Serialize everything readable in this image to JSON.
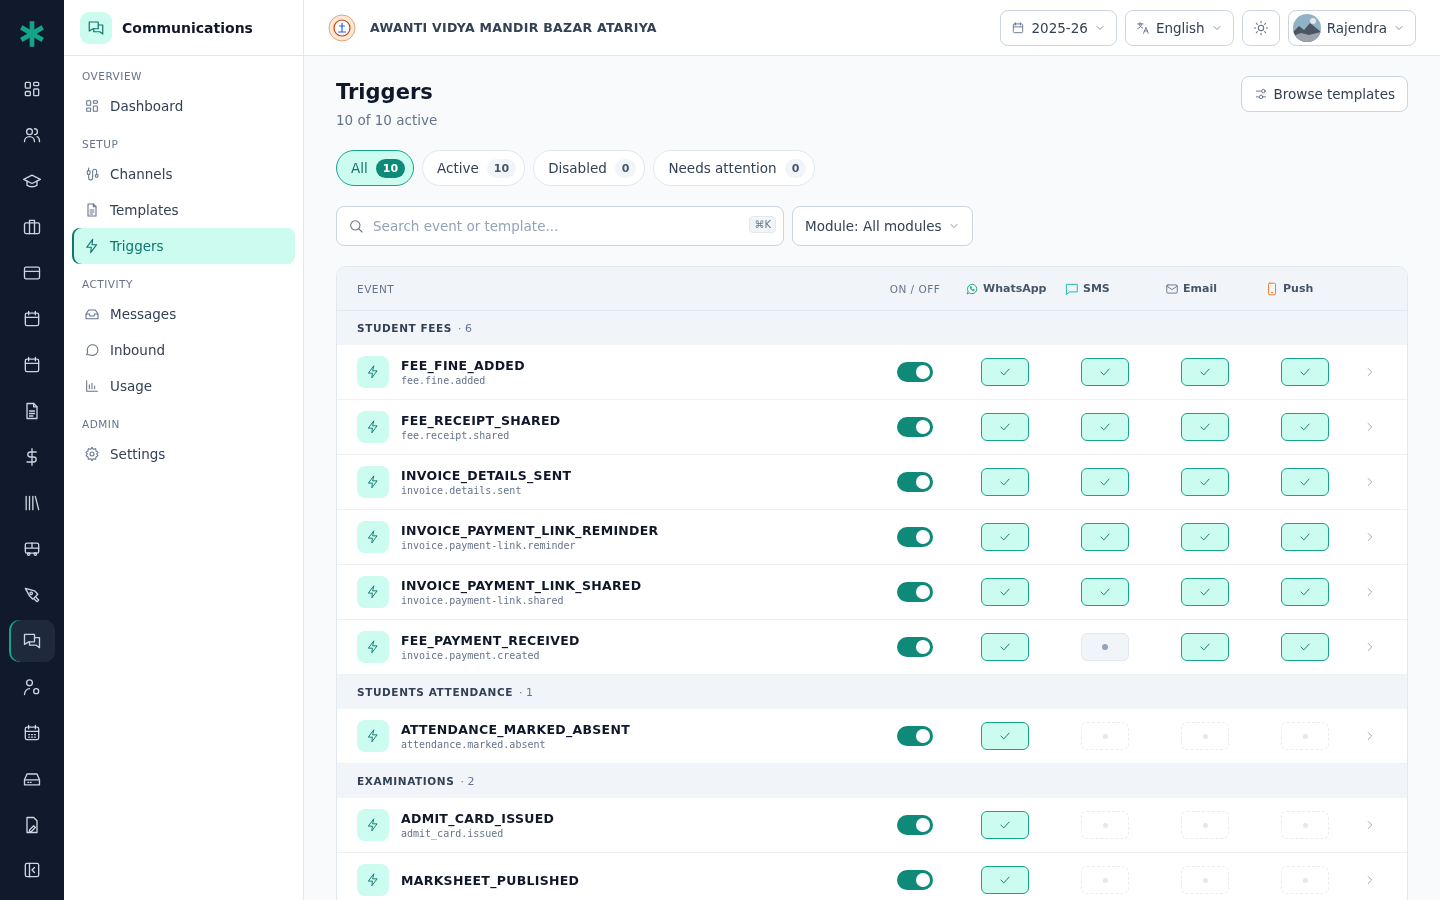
{
  "rail": [
    {
      "kind": "grid",
      "selected": false
    },
    {
      "kind": "users",
      "selected": false
    },
    {
      "kind": "cap",
      "selected": false
    },
    {
      "kind": "briefcase",
      "selected": false
    },
    {
      "kind": "card",
      "selected": false
    },
    {
      "kind": "calendar",
      "selected": false
    },
    {
      "kind": "calendar",
      "selected": false
    },
    {
      "kind": "doc",
      "selected": false
    },
    {
      "kind": "dollar",
      "selected": false
    },
    {
      "kind": "library",
      "selected": false
    },
    {
      "kind": "bus",
      "selected": false
    },
    {
      "kind": "pen",
      "selected": false
    },
    {
      "kind": "chat",
      "selected": true
    },
    {
      "kind": "usergear",
      "selected": false
    },
    {
      "kind": "calgrid",
      "selected": false
    },
    {
      "kind": "tray",
      "selected": false
    },
    {
      "kind": "filepen",
      "selected": false
    }
  ],
  "sidebar": {
    "title": "Communications",
    "sections": [
      {
        "label": "OVERVIEW",
        "items": [
          {
            "kind": "grid",
            "label": "Dashboard",
            "selected": false
          }
        ]
      },
      {
        "label": "SETUP",
        "items": [
          {
            "kind": "plug",
            "label": "Channels",
            "selected": false
          },
          {
            "kind": "doc",
            "label": "Templates",
            "selected": false
          },
          {
            "kind": "bolt",
            "label": "Triggers",
            "selected": true
          }
        ]
      },
      {
        "label": "ACTIVITY",
        "items": [
          {
            "kind": "inbox",
            "label": "Messages",
            "selected": false
          },
          {
            "kind": "bubble",
            "label": "Inbound",
            "selected": false
          },
          {
            "kind": "bars",
            "label": "Usage",
            "selected": false
          }
        ]
      },
      {
        "label": "ADMIN",
        "items": [
          {
            "kind": "gear",
            "label": "Settings",
            "selected": false
          }
        ]
      }
    ]
  },
  "header": {
    "school": "AWANTI VIDYA MANDIR BAZAR ATARIYA",
    "year": "2025-26",
    "language": "English",
    "user": "Rajendra"
  },
  "page": {
    "title": "Triggers",
    "subtitle": "10 of 10 active",
    "action": "Browse templates"
  },
  "filters": [
    {
      "label": "All",
      "count": "10",
      "selected": true
    },
    {
      "label": "Active",
      "count": "10",
      "selected": false
    },
    {
      "label": "Disabled",
      "count": "0",
      "selected": false
    },
    {
      "label": "Needs attention",
      "count": "0",
      "selected": false
    }
  ],
  "search": {
    "placeholder": "Search event or template...",
    "shortcut": "⌘K"
  },
  "module_select": "Module: All modules",
  "table": {
    "columns": [
      {
        "kind": "text",
        "label": "EVENT"
      },
      {
        "kind": "text",
        "label": "ON / OFF"
      },
      {
        "kind": "whatsapp",
        "label": "WhatsApp"
      },
      {
        "kind": "sms",
        "label": "SMS"
      },
      {
        "kind": "email",
        "label": "Email"
      },
      {
        "kind": "push",
        "label": "Push"
      }
    ],
    "groups": [
      {
        "name": "STUDENT FEES",
        "count": "· 6",
        "rows": [
          {
            "name": "FEE_FINE_ADDED",
            "key": "fee.fine.added",
            "on": true,
            "channels": [
              {
                "available": true,
                "enabled": true
              },
              {
                "available": true,
                "enabled": true
              },
              {
                "available": true,
                "enabled": true
              },
              {
                "available": true,
                "enabled": true
              }
            ]
          },
          {
            "name": "FEE_RECEIPT_SHARED",
            "key": "fee.receipt.shared",
            "on": true,
            "channels": [
              {
                "available": true,
                "enabled": true
              },
              {
                "available": true,
                "enabled": true
              },
              {
                "available": true,
                "enabled": true
              },
              {
                "available": true,
                "enabled": true
              }
            ]
          },
          {
            "name": "INVOICE_DETAILS_SENT",
            "key": "invoice.details.sent",
            "on": true,
            "channels": [
              {
                "available": true,
                "enabled": true
              },
              {
                "available": true,
                "enabled": true
              },
              {
                "available": true,
                "enabled": true
              },
              {
                "available": true,
                "enabled": true
              }
            ]
          },
          {
            "name": "INVOICE_PAYMENT_LINK_REMINDER",
            "key": "invoice.payment-link.reminder",
            "on": true,
            "channels": [
              {
                "available": true,
                "enabled": true
              },
              {
                "available": true,
                "enabled": true
              },
              {
                "available": true,
                "enabled": true
              },
              {
                "available": true,
                "enabled": true
              }
            ]
          },
          {
            "name": "INVOICE_PAYMENT_LINK_SHARED",
            "key": "invoice.payment-link.shared",
            "on": true,
            "channels": [
              {
                "available": true,
                "enabled": true
              },
              {
                "available": true,
                "enabled": true
              },
              {
                "available": true,
                "enabled": true
              },
              {
                "available": true,
                "enabled": true
              }
            ]
          },
          {
            "name": "FEE_PAYMENT_RECEIVED",
            "key": "invoice.payment.created",
            "on": true,
            "channels": [
              {
                "available": true,
                "enabled": true
              },
              {
                "available": true,
                "enabled": false
              },
              {
                "available": true,
                "enabled": true
              },
              {
                "available": true,
                "enabled": true
              }
            ]
          }
        ]
      },
      {
        "name": "STUDENTS ATTENDANCE",
        "count": "· 1",
        "rows": [
          {
            "name": "ATTENDANCE_MARKED_ABSENT",
            "key": "attendance.marked.absent",
            "on": true,
            "channels": [
              {
                "available": true,
                "enabled": true
              },
              {
                "available": false
              },
              {
                "available": false
              },
              {
                "available": false
              }
            ]
          }
        ]
      },
      {
        "name": "EXAMINATIONS",
        "count": "· 2",
        "rows": [
          {
            "name": "ADMIT_CARD_ISSUED",
            "key": "admit_card.issued",
            "on": true,
            "channels": [
              {
                "available": true,
                "enabled": true
              },
              {
                "available": false
              },
              {
                "available": false
              },
              {
                "available": false
              }
            ]
          },
          {
            "name": "MARKSHEET_PUBLISHED",
            "on": true,
            "channels": [
              {
                "available": true,
                "enabled": true
              },
              {
                "available": false
              },
              {
                "available": false
              },
              {
                "available": false
              }
            ]
          }
        ]
      }
    ]
  }
}
